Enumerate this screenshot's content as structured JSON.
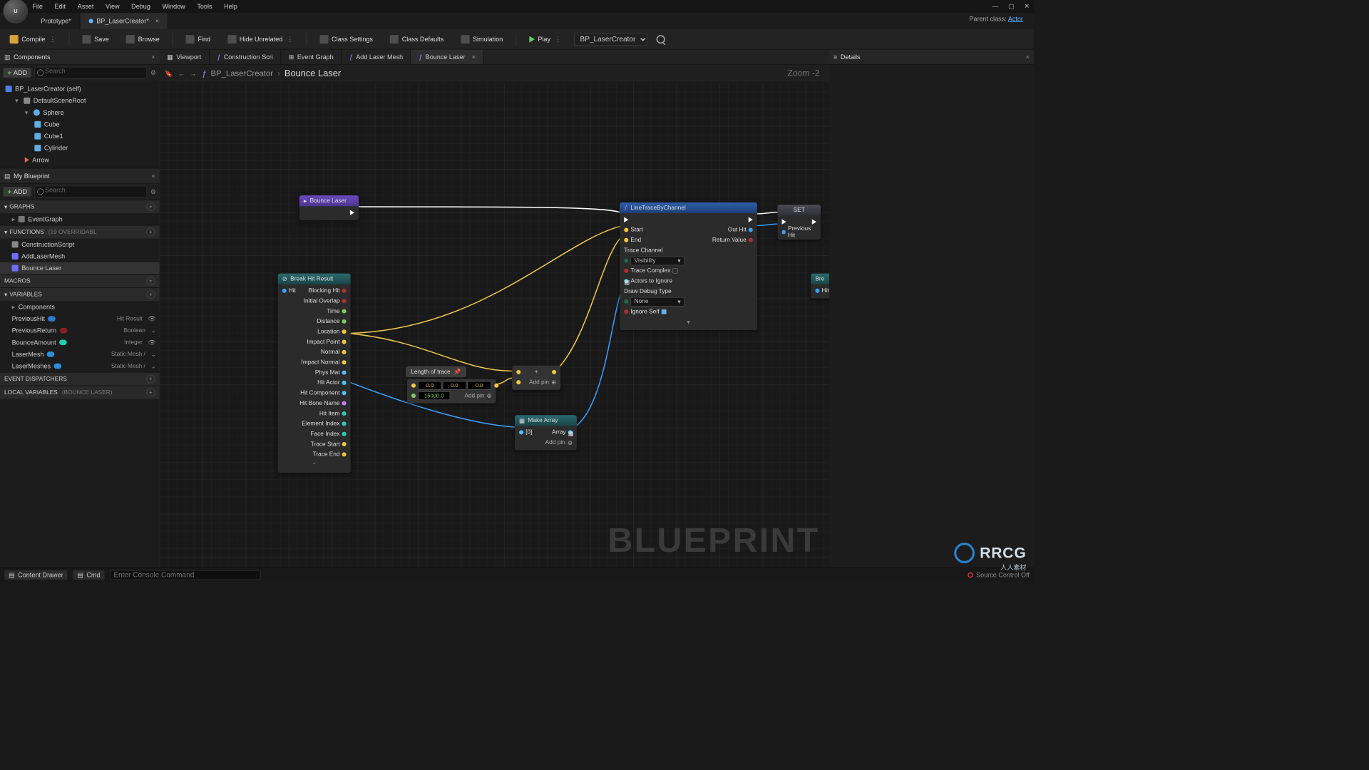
{
  "menu": {
    "items": [
      "File",
      "Edit",
      "Asset",
      "View",
      "Debug",
      "Window",
      "Tools",
      "Help"
    ]
  },
  "win": {
    "min": "—",
    "max": "▢",
    "close": "✕"
  },
  "mainTabs": [
    {
      "label": "Prototype*",
      "active": false,
      "hasDot": false,
      "closable": false
    },
    {
      "label": "BP_LaserCreator*",
      "active": true,
      "hasDot": true,
      "closable": true
    }
  ],
  "parentClass": {
    "label": "Parent class:",
    "value": "Actor"
  },
  "toolbar": {
    "compile": "Compile",
    "save": "Save",
    "browse": "Browse",
    "find": "Find",
    "hide": "Hide Unrelated",
    "classSettings": "Class Settings",
    "classDefaults": "Class Defaults",
    "simulation": "Simulation",
    "play": "Play",
    "target": "BP_LaserCreator"
  },
  "componentsPanel": {
    "title": "Components",
    "add": "ADD",
    "searchPlaceholder": "Search",
    "tree": [
      {
        "label": "BP_LaserCreator (self)",
        "depth": 0,
        "icon": "bp"
      },
      {
        "label": "DefaultSceneRoot",
        "depth": 1,
        "icon": "scene"
      },
      {
        "label": "Sphere",
        "depth": 2,
        "icon": "sphere"
      },
      {
        "label": "Cube",
        "depth": 3,
        "icon": "cube"
      },
      {
        "label": "Cube1",
        "depth": 3,
        "icon": "cube"
      },
      {
        "label": "Cylinder",
        "depth": 3,
        "icon": "cube"
      },
      {
        "label": "Arrow",
        "depth": 2,
        "icon": "arrow"
      }
    ]
  },
  "myBlueprint": {
    "title": "My Blueprint",
    "add": "ADD",
    "searchPlaceholder": "Search",
    "graphs": {
      "title": "GRAPHS",
      "items": [
        "EventGraph"
      ]
    },
    "functions": {
      "title": "FUNCTIONS",
      "suffix": "(19 OVERRIDABL",
      "items": [
        "ConstructionScript",
        "AddLaserMesh",
        "Bounce Laser"
      ]
    },
    "macros": {
      "title": "MACROS"
    },
    "variables": {
      "title": "VARIABLES",
      "componentsGroup": "Components",
      "items": [
        {
          "name": "PreviousHit",
          "type": "Hit Result",
          "color": "#2d7bd6",
          "eye": true
        },
        {
          "name": "PreviousReturn",
          "type": "Boolean",
          "color": "#8a1f1f",
          "eye": false
        },
        {
          "name": "BounceAmount",
          "type": "Integer",
          "color": "#1fceb3",
          "eye": true
        },
        {
          "name": "LaserMesh",
          "type": "Static Mesh /",
          "color": "#2f8fd6",
          "eye": false,
          "asset": true
        },
        {
          "name": "LaserMeshes",
          "type": "Static Mesh /",
          "color": "#2f8fd6",
          "eye": false,
          "array": true
        }
      ]
    },
    "dispatchers": {
      "title": "EVENT DISPATCHERS"
    },
    "localVars": {
      "title": "LOCAL VARIABLES",
      "suffix": "(BOUNCE LASER)"
    }
  },
  "editorTabs": [
    {
      "label": "Viewport",
      "icon": "viewport",
      "active": false
    },
    {
      "label": "Construction Scri",
      "icon": "fn",
      "active": false
    },
    {
      "label": "Event Graph",
      "icon": "graph",
      "active": false
    },
    {
      "label": "Add Laser Mesh",
      "icon": "fn",
      "active": false
    },
    {
      "label": "Bounce Laser",
      "icon": "fn",
      "active": true,
      "closable": true
    }
  ],
  "breadcrumb": {
    "parent": "BP_LaserCreator",
    "sep": "›",
    "current": "Bounce Laser"
  },
  "zoom": "Zoom  -2",
  "nodes": {
    "entry": {
      "title": "Bounce Laser"
    },
    "breakHit": {
      "title": "Break Hit Result",
      "in": [
        "Hit"
      ],
      "out": [
        "Blocking Hit",
        "Initial Overlap",
        "Time",
        "Distance",
        "Location",
        "Impact Point",
        "Normal",
        "Impact Normal",
        "Phys Mat",
        "Hit Actor",
        "Hit Component",
        "Hit Bone Name",
        "Hit Item",
        "Element Index",
        "Face Index",
        "Trace Start",
        "Trace End"
      ]
    },
    "lengthComment": "Length of trace",
    "multiply": {
      "vec": [
        "0.0",
        "0.0",
        "0.0"
      ],
      "float": "15000.0",
      "addpin": "Add pin"
    },
    "add": {
      "addpin": "Add pin"
    },
    "makeArray": {
      "title": "Make Array",
      "row": "[0]",
      "out": "Array",
      "addpin": "Add pin"
    },
    "lineTrace": {
      "title": "LineTraceByChannel",
      "start": "Start",
      "end": "End",
      "traceChannel": "Trace Channel",
      "visibility": "Visibility",
      "traceComplex": "Trace Complex",
      "actorsToIgnore": "Actors to Ignore",
      "drawDebug": "Draw Debug Type",
      "none": "None",
      "ignoreSelf": "Ignore Self",
      "outHit": "Out Hit",
      "returnValue": "Return Value"
    },
    "set": {
      "title": "SET",
      "var": "Previous Hit"
    },
    "break2": {
      "title": "Bre",
      "hit": "Hit"
    }
  },
  "details": {
    "title": "Details"
  },
  "status": {
    "contentDrawer": "Content Drawer",
    "cmd": "Cmd",
    "cmdPlaceholder": "Enter Console Command",
    "source": "Source Control Off"
  },
  "blueprintWatermark": "BLUEPRINT",
  "brand": {
    "name": "RRCG",
    "sub": "人人素材"
  }
}
